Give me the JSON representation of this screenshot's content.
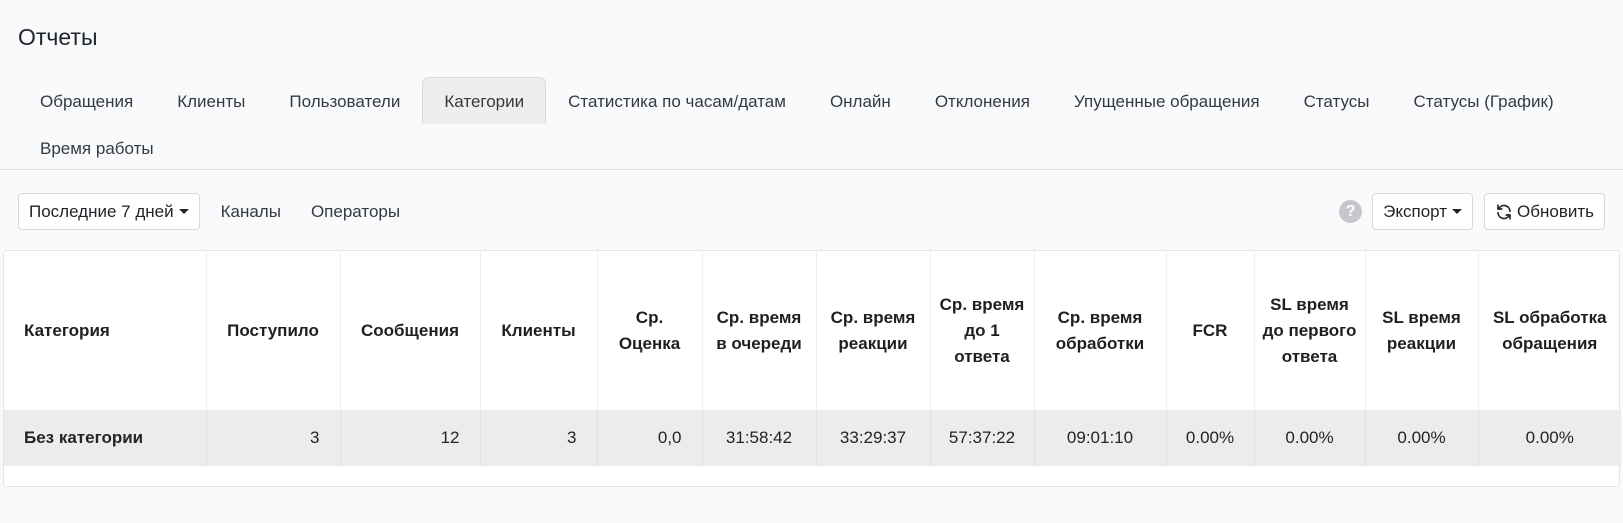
{
  "page": {
    "title": "Отчеты"
  },
  "tabs": {
    "row1": [
      {
        "label": "Обращения"
      },
      {
        "label": "Клиенты"
      },
      {
        "label": "Пользователи"
      },
      {
        "label": "Категории",
        "active": true
      },
      {
        "label": "Статистика по часам/датам"
      },
      {
        "label": "Онлайн"
      },
      {
        "label": "Отклонения"
      },
      {
        "label": "Упущенные обращения"
      },
      {
        "label": "Статусы"
      },
      {
        "label": "Статусы (График)"
      }
    ],
    "row2": [
      {
        "label": "Время работы"
      }
    ]
  },
  "toolbar": {
    "period_label": "Последние 7 дней",
    "channels_label": "Каналы",
    "operators_label": "Операторы",
    "help_label": "?",
    "export_label": "Экспорт",
    "refresh_label": "Обновить"
  },
  "icons": {
    "help": "question-circle-icon",
    "refresh": "refresh-icon",
    "caret": "caret-down-icon"
  },
  "table": {
    "headers": [
      "Категория",
      "Поступило",
      "Сообщения",
      "Клиенты",
      "Ср. Оценка",
      "Ср. время в очереди",
      "Ср. время реакции",
      "Ср. время до 1 ответа",
      "Ср. время обработки",
      "FCR",
      "SL время до первого ответа",
      "SL время реакции",
      "SL обработка обращения"
    ],
    "rows": [
      [
        "Без категории",
        "3",
        "12",
        "3",
        "0,0",
        "31:58:42",
        "33:29:37",
        "57:37:22",
        "09:01:10",
        "0.00%",
        "0.00%",
        "0.00%",
        "0.00%"
      ]
    ]
  },
  "colors": {
    "background": "#f9fafc",
    "active_tab": "#eeeeee",
    "row_background": "#ececec",
    "help_icon": "#c5c7ca"
  }
}
